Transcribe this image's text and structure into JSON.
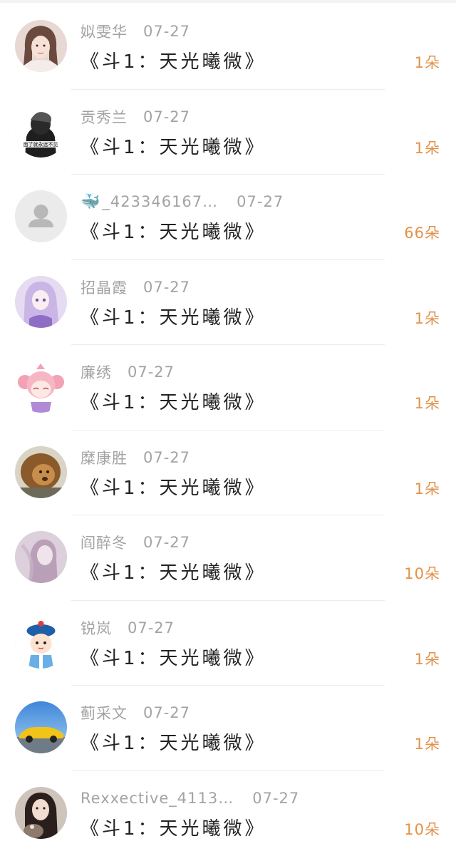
{
  "items": [
    {
      "name": "姒雯华",
      "date": "07-27",
      "title": "《斗1：天光曦微》",
      "amount": "1朵",
      "avatar": "girl-photo-avatar"
    },
    {
      "name": "贡秀兰",
      "date": "07-27",
      "title": "《斗1：天光曦微》",
      "amount": "1朵",
      "avatar": "black-hoodie-avatar",
      "avatar_caption": "面了就永远不见"
    },
    {
      "name": "_423346167…",
      "date": "07-27",
      "title": "《斗1：天光曦微》",
      "amount": "66朵",
      "avatar": "default-person-avatar",
      "name_icon": "whale-icon"
    },
    {
      "name": "招晶霞",
      "date": "07-27",
      "title": "《斗1：天光曦微》",
      "amount": "1朵",
      "avatar": "anime-girl-avatar"
    },
    {
      "name": "廉绣",
      "date": "07-27",
      "title": "《斗1：天光曦微》",
      "amount": "1朵",
      "avatar": "pink-cartoon-avatar"
    },
    {
      "name": "糜康胜",
      "date": "07-27",
      "title": "《斗1：天光曦微》",
      "amount": "1朵",
      "avatar": "lion-avatar"
    },
    {
      "name": "阎醉冬",
      "date": "07-27",
      "title": "《斗1：天光曦微》",
      "amount": "10朵",
      "avatar": "purple-portrait-avatar"
    },
    {
      "name": "锐岚",
      "date": "07-27",
      "title": "《斗1：天光曦微》",
      "amount": "1朵",
      "avatar": "qing-official-cartoon-avatar"
    },
    {
      "name": "蓟采文",
      "date": "07-27",
      "title": "《斗1：天光曦微》",
      "amount": "1朵",
      "avatar": "yellow-car-avatar"
    },
    {
      "name": "Rexxective_4113…",
      "date": "07-27",
      "title": "《斗1：天光曦微》",
      "amount": "10朵",
      "avatar": "woman-with-cat-avatar"
    }
  ],
  "colors": {
    "name_gray": "#a3a3a3",
    "title_dark": "#222222",
    "amount_orange": "#e3914a",
    "divider": "#ececec"
  }
}
